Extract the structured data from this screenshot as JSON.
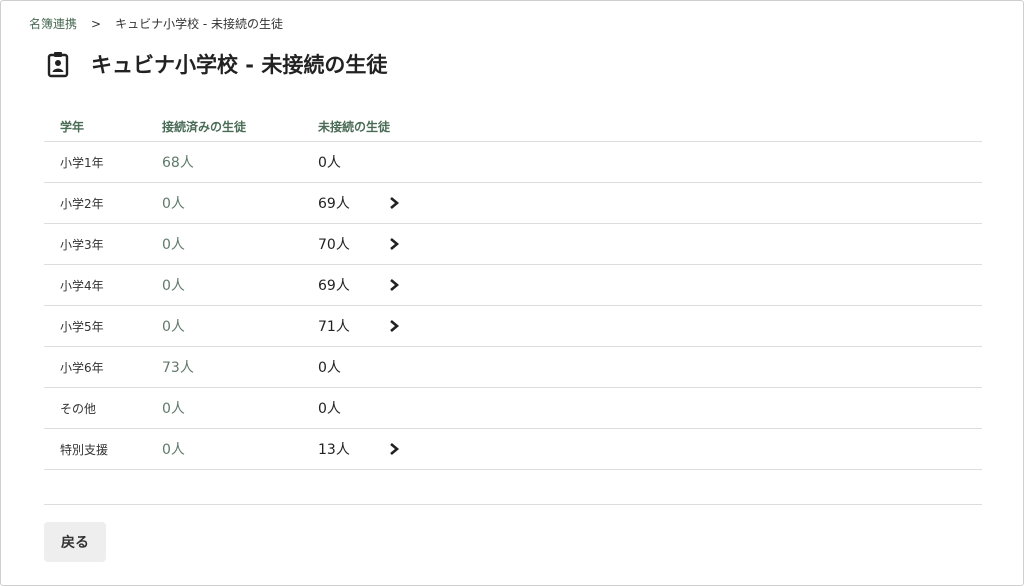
{
  "breadcrumb": {
    "root": "名簿連携",
    "separator": ">",
    "current": "キュビナ小学校 - 未接続の生徒"
  },
  "page": {
    "title": "キュビナ小学校 - 未接続の生徒",
    "title_icon": "id-badge-icon"
  },
  "table": {
    "headers": {
      "grade": "学年",
      "connected": "接続済みの生徒",
      "unconnected": "未接続の生徒"
    },
    "rows": [
      {
        "grade": "小学1年",
        "connected": "68人",
        "unconnected": "0人",
        "has_detail": false
      },
      {
        "grade": "小学2年",
        "connected": "0人",
        "unconnected": "69人",
        "has_detail": true
      },
      {
        "grade": "小学3年",
        "connected": "0人",
        "unconnected": "70人",
        "has_detail": true
      },
      {
        "grade": "小学4年",
        "connected": "0人",
        "unconnected": "69人",
        "has_detail": true
      },
      {
        "grade": "小学5年",
        "connected": "0人",
        "unconnected": "71人",
        "has_detail": true
      },
      {
        "grade": "小学6年",
        "connected": "73人",
        "unconnected": "0人",
        "has_detail": false
      },
      {
        "grade": "その他",
        "connected": "0人",
        "unconnected": "0人",
        "has_detail": false
      },
      {
        "grade": "特別支援",
        "connected": "0人",
        "unconnected": "13人",
        "has_detail": true
      }
    ]
  },
  "footer": {
    "back_label": "戻る"
  },
  "colors": {
    "accent_green": "#4a6b55",
    "muted_green_text": "#5f7a6a",
    "border": "#dddddd",
    "button_bg": "#eeeeee"
  },
  "icons": {
    "row_detail": "chevron-right-icon"
  }
}
